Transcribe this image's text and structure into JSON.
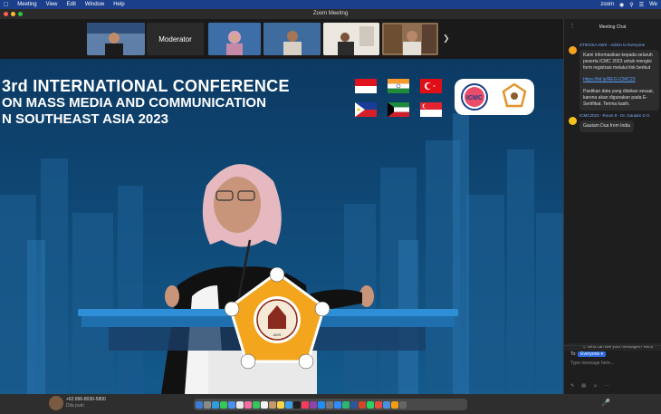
{
  "menubar": {
    "items": [
      "Meeting",
      "View",
      "Edit",
      "Window",
      "Help"
    ],
    "app_right": "zoom",
    "clock": "We"
  },
  "window": {
    "title": "Zoom Meeting"
  },
  "participants": [
    {
      "label": ""
    },
    {
      "label": "Moderator"
    },
    {
      "label": ""
    },
    {
      "label": ""
    },
    {
      "label": ""
    },
    {
      "label": ""
    }
  ],
  "slide": {
    "line1": "3rd  INTERNATIONAL CONFERENCE",
    "line2": "ON MASS MEDIA AND COMMUNICATION",
    "line3": "N SOUTHEAST ASIA 2023",
    "logo_text": "SEKOLAH TINGGI ILMU KOMUNIKASI PRAPANCA",
    "logo_abbr": "AWS",
    "colors": {
      "background": "#0f3d66",
      "podium": "#1e78c0",
      "emblem": "#f3a51d"
    }
  },
  "chat": {
    "title": "Meeting Chat",
    "messages": [
      {
        "sender": "STIKOSA AWS - Admin to Everyone",
        "body": "Kami informasikan kepada seluruh peserta ICMC 2023 untuk mengisi form registrasi melalui link berikut",
        "link": "https://bit.ly/REG-ICMC23",
        "note": "Pastikan data yang diisikan sesuai, karena akan digunakan pada E-Sertifikat. Terima kasih."
      },
      {
        "sender": "ICMC2023 - Room 8 - Dr. Gautam D G",
        "body": "Gautam Dua from India"
      }
    ],
    "who_can_see": "Who can see your messages? Reco",
    "to_label": "To:",
    "recipient": "Everyone",
    "placeholder": "Type message here..."
  },
  "dock": {
    "caller_number": "+62 896-8030-5800",
    "caller_name": "Dila putri"
  }
}
